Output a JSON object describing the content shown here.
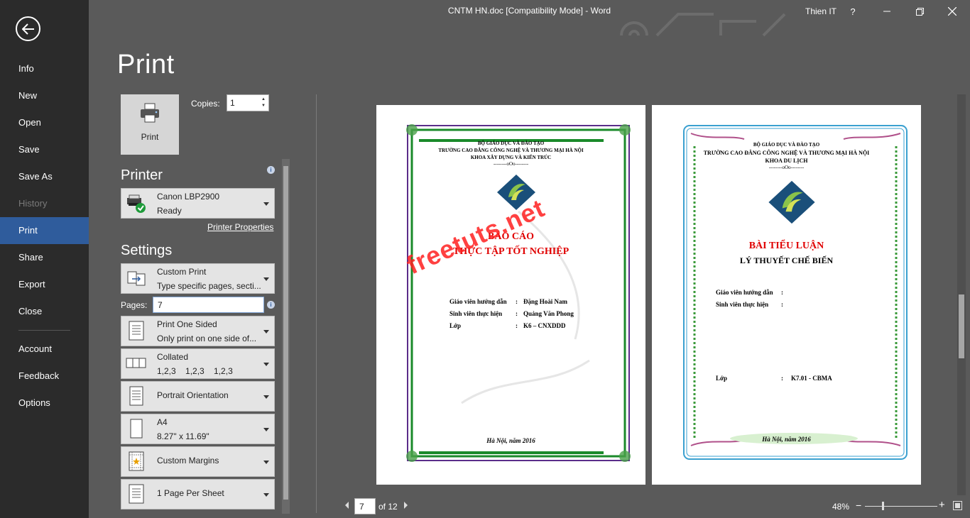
{
  "window": {
    "title": "CNTM HN.doc [Compatibility Mode]  -  Word",
    "user": "Thien IT",
    "help": "?"
  },
  "sidebar": {
    "items": [
      {
        "label": "Info"
      },
      {
        "label": "New"
      },
      {
        "label": "Open"
      },
      {
        "label": "Save"
      },
      {
        "label": "Save As"
      },
      {
        "label": "History"
      },
      {
        "label": "Print"
      },
      {
        "label": "Share"
      },
      {
        "label": "Export"
      },
      {
        "label": "Close"
      }
    ],
    "bottom_items": [
      {
        "label": "Account"
      },
      {
        "label": "Feedback"
      },
      {
        "label": "Options"
      }
    ]
  },
  "page_title": "Print",
  "print_button": {
    "label": "Print"
  },
  "copies": {
    "label": "Copies:",
    "value": "1"
  },
  "printer": {
    "heading": "Printer",
    "name": "Canon LBP2900",
    "status": "Ready",
    "properties_link": "Printer Properties"
  },
  "settings": {
    "heading": "Settings",
    "print_range": {
      "title": "Custom Print",
      "subtitle": "Type specific pages, secti..."
    },
    "pages": {
      "label": "Pages:",
      "value": "7"
    },
    "sides": {
      "title": "Print One Sided",
      "subtitle": "Only print on one side of..."
    },
    "collation": {
      "title": "Collated",
      "subtitle": "1,2,3    1,2,3    1,2,3"
    },
    "orientation": {
      "title": "Portrait Orientation"
    },
    "paper": {
      "title": "A4",
      "subtitle": "8.27\" x 11.69\""
    },
    "margins": {
      "title": "Custom Margins"
    },
    "per_sheet": {
      "title": "1 Page Per Sheet"
    }
  },
  "preview": {
    "watermark": "freetuts.net",
    "page1": {
      "header": [
        "BỘ GIÁO DỤC VÀ ĐÀO TẠO",
        "TRƯỜNG CAO ĐẲNG CÔNG NGHỆ VÀ THƯƠNG MẠI HÀ NỘI",
        "KHOA XÂY DỰNG VÀ KIẾN TRÚC",
        "--------oOo--------"
      ],
      "title1": "BÁO CÁO",
      "title2": "THỰC TẬP TỐT NGHIỆP",
      "fields": [
        {
          "label": "Giáo viên hướng dẫn",
          "sep": ":",
          "value": "Đặng Hoài Nam"
        },
        {
          "label": "Sinh viên thực hiện",
          "sep": ":",
          "value": "Quảng Văn Phong"
        },
        {
          "label": "Lớp",
          "sep": ":",
          "value": "K6 – CNXDDD"
        }
      ],
      "footer": "Hà Nội, năm 2016"
    },
    "page2": {
      "header": [
        "BỘ GIÁO DỤC VÀ ĐÀO TẠO",
        "TRƯỜNG CAO ĐẲNG CÔNG NGHỆ VÀ THƯƠNG MẠI HÀ NỘI",
        "KHOA DU LỊCH",
        "--------oOo--------"
      ],
      "title1": "BÀI TIỂU LUẬN",
      "title2": "LÝ THUYẾT CHẾ BIẾN",
      "fields": [
        {
          "label": "Giáo viên hướng dẫn",
          "sep": ":",
          "value": ""
        },
        {
          "label": "Sinh viên thực hiện",
          "sep": ":",
          "value": ""
        },
        {
          "label": "Lớp",
          "sep": ":",
          "value": "K7.01 - CBMA"
        }
      ],
      "footer": "Hà Nội, năm 2016"
    }
  },
  "navigation": {
    "current_page": "7",
    "of_label": "of 12",
    "zoom": "48%"
  },
  "colors": {
    "sidebar": "#2b2b2b",
    "active": "#2f5c9c",
    "background": "#5a5a5a",
    "page1_border": "#1a8a2a",
    "page2_border": "#3aa0d0",
    "title_red": "#e00000"
  }
}
